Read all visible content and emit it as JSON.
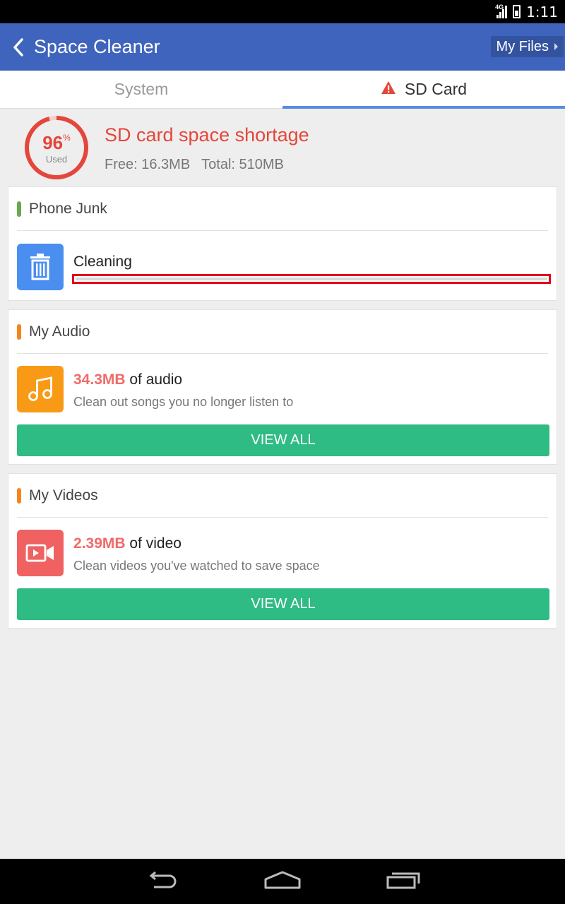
{
  "status_bar": {
    "network": "4G",
    "time": "1:11"
  },
  "app_bar": {
    "title": "Space Cleaner",
    "my_files_label": "My Files"
  },
  "tabs": [
    {
      "label": "System",
      "selected": false
    },
    {
      "label": "SD Card",
      "selected": true,
      "warning_icon": "warning-icon"
    }
  ],
  "storage": {
    "used_percent": 96,
    "percent_value": "96",
    "percent_sign": "%",
    "used_label": "Used",
    "title": "SD card space shortage",
    "free": "Free: 16.3MB",
    "total": "Total: 510MB"
  },
  "cards": {
    "junk": {
      "title": "Phone Junk",
      "icon": "trash-icon",
      "status": "Cleaning",
      "progress": 0
    },
    "audio": {
      "title": "My Audio",
      "icon": "music-note-icon",
      "size": "34.3MB",
      "suffix": "of audio",
      "description": "Clean out songs you no longer listen to",
      "button": "VIEW ALL"
    },
    "videos": {
      "title": "My Videos",
      "icon": "video-camera-icon",
      "size": "2.39MB",
      "suffix": "of video",
      "description": "Clean videos you've watched to save space",
      "button": "VIEW ALL"
    }
  },
  "colors": {
    "app_bar": "#3f64bd",
    "warning_red": "#e5463b",
    "accent_blue": "#5b8be0",
    "green_button": "#2fbb84",
    "junk_bar": "#6aa84f",
    "orange_bar": "#f5841f",
    "audio_icon_bg": "#f99a16",
    "video_icon_bg": "#f06262",
    "trash_icon_bg": "#4a8ef0"
  },
  "nav_bar": {
    "icons": [
      "back-icon",
      "home-icon",
      "recent-apps-icon"
    ]
  }
}
